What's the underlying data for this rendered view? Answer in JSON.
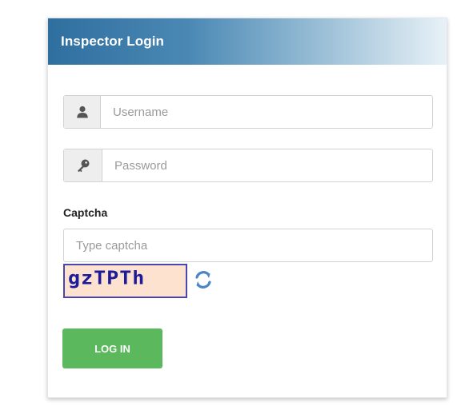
{
  "panel": {
    "title": "Inspector Login"
  },
  "form": {
    "username": {
      "placeholder": "Username",
      "value": "",
      "icon": "user-icon"
    },
    "password": {
      "placeholder": "Password",
      "value": "",
      "icon": "key-icon"
    },
    "captcha_label": "Captcha",
    "captcha_input": {
      "placeholder": "Type captcha",
      "value": ""
    },
    "captcha_image_text": "gzTPTh",
    "refresh_icon": "refresh-icon",
    "login_label": "LOG IN"
  },
  "colors": {
    "header_gradient_start": "#2f6f9f",
    "header_gradient_end": "#e8f1f7",
    "login_button": "#5cb85c",
    "captcha_bg": "#fde3cf",
    "captcha_text": "#1b1b9c",
    "refresh_icon": "#4a86c5"
  }
}
